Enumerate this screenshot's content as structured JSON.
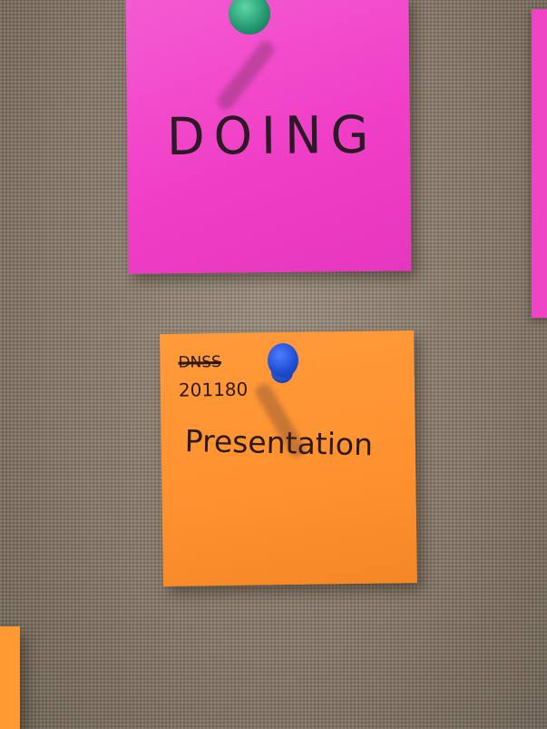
{
  "scene": {
    "surface": "burlap-corkboard",
    "notes": [
      {
        "color": "#f03fc7",
        "text": "DOING",
        "pin_color": "#249b72"
      },
      {
        "color": "#ff912f",
        "crossed_out_text": "DNSS",
        "code": "201180",
        "text": "Presentation",
        "pin_color": "#1f4fd6"
      }
    ],
    "edge_note_colors": [
      "#ee45c5",
      "#ff9a33"
    ]
  }
}
